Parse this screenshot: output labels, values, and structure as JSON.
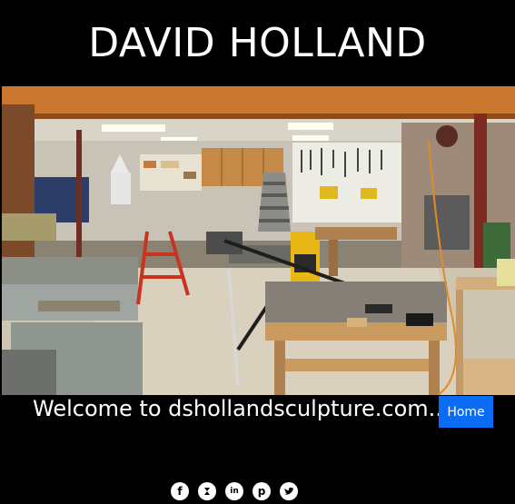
{
  "header": {
    "title": "DAVID HOLLAND"
  },
  "hero": {
    "alt_icon": "workshop-photo"
  },
  "welcome": {
    "text": "Welcome to dshollandsculpture.com..."
  },
  "nav": {
    "home_label": "Home"
  },
  "social": [
    {
      "name": "facebook",
      "glyph": "f"
    },
    {
      "name": "deviantart",
      "glyph": ""
    },
    {
      "name": "linkedin",
      "glyph": "in"
    },
    {
      "name": "pinterest",
      "glyph": "p"
    },
    {
      "name": "twitter",
      "glyph": ""
    }
  ],
  "colors": {
    "background": "#000000",
    "home_button": "#0a6cf5",
    "text": "#ffffff"
  }
}
